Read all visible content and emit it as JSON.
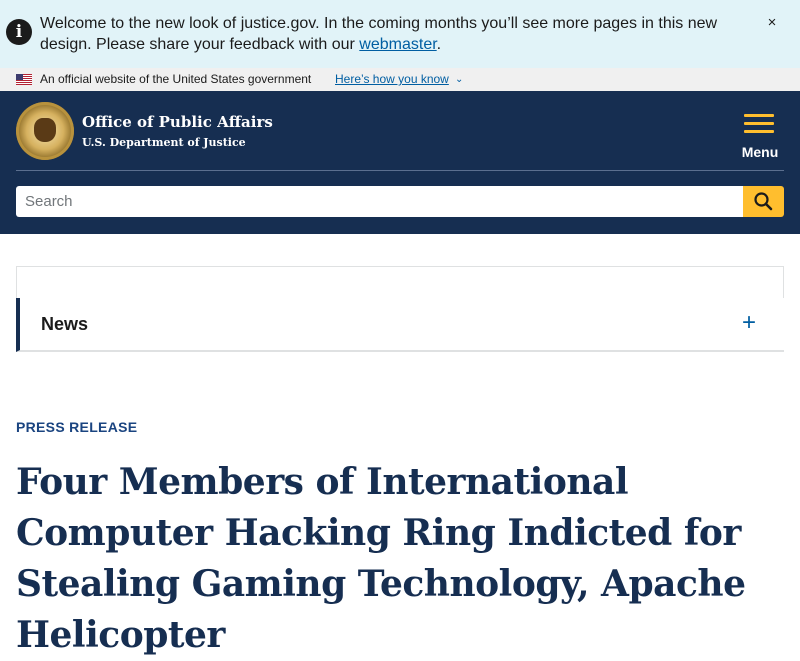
{
  "alert": {
    "text_before": "Welcome to the new look of justice.gov. In the coming months you’ll see more pages in this new design. Please share your feedback with our ",
    "link": "webmaster",
    "text_after": ".",
    "icon": "info-icon",
    "close": "×"
  },
  "gov_banner": {
    "text": "An official website of the United States government",
    "link": "Here’s how you know",
    "chevron": "⌄"
  },
  "header": {
    "title": "Office of Public Affairs",
    "subtitle": "U.S. Department of Justice",
    "menu_label": "Menu",
    "accent": "#ffbe2e",
    "background": "#162e51"
  },
  "search": {
    "placeholder": "Search",
    "button_icon": "search-icon"
  },
  "news": {
    "label": "News",
    "toggle": "+"
  },
  "article": {
    "kicker": "PRESS RELEASE",
    "headline": "Four Members of International Computer Hacking Ring Indicted for Stealing Gaming Technology, Apache Helicopter"
  }
}
